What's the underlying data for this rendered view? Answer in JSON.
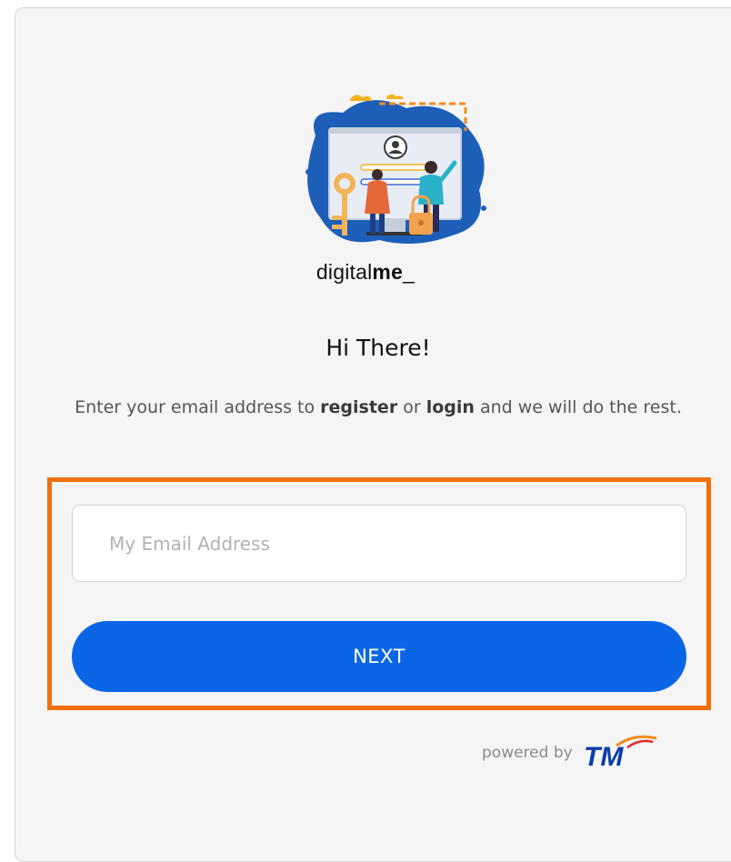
{
  "brand": {
    "prefix": "digital",
    "suffix": "me",
    "underscore": "_"
  },
  "greeting": "Hi There!",
  "subtitle": {
    "part1": "Enter your email address to ",
    "register": "register",
    "part2": " or ",
    "login": "login",
    "part3": " and we will do the rest."
  },
  "email_input": {
    "placeholder": "My Email Address",
    "value": ""
  },
  "next_button": {
    "label": "NEXT"
  },
  "footer": {
    "powered_by": "powered by",
    "partner_logo_text": "TM"
  },
  "colors": {
    "primary": "#0a66e6",
    "highlight": "#f06f0c",
    "card_bg": "#f5f5f5"
  },
  "icons": [
    "login-illustration",
    "tm-logo"
  ]
}
